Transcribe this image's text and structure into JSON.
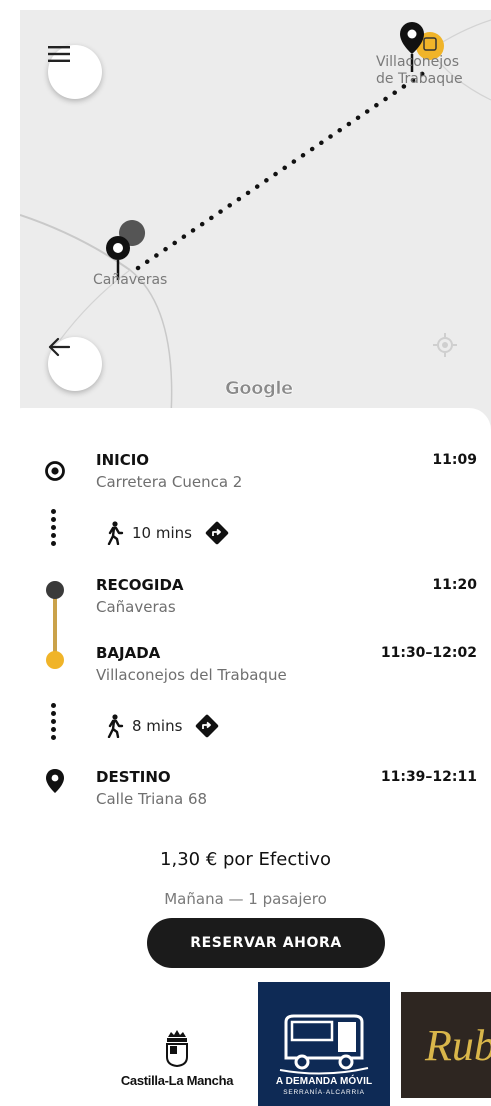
{
  "map": {
    "town_origin": "Villaconejos\nde Trabaque",
    "town_destination": "Cañaveras",
    "provider_logo": "Google",
    "menu_icon": "hamburger-menu-icon",
    "back_icon": "arrow-left-icon",
    "locate_icon": "crosshair-icon"
  },
  "trip": {
    "start": {
      "label": "INICIO",
      "address": "Carretera Cuenca 2",
      "time": "11:09"
    },
    "walk1": {
      "duration": "10 mins"
    },
    "pickup": {
      "label": "RECOGIDA",
      "address": "Cañaveras",
      "time": "11:20"
    },
    "dropoff": {
      "label": "BAJADA",
      "address": "Villaconejos del Trabaque",
      "time": "11:30–12:02"
    },
    "walk2": {
      "duration": "8 mins"
    },
    "destination": {
      "label": "DESTINO",
      "address": "Calle Triana 68",
      "time": "11:39–12:11"
    }
  },
  "booking": {
    "price": "1,30 € por Efectivo",
    "details": "Mañana — 1 pasajero",
    "button_label": "RESERVAR AHORA"
  },
  "logos": {
    "clm": "Castilla-La Mancha",
    "adm_title": "A DEMANDA MÓVIL",
    "adm_sub": "SERRANÍA·ALCARRIA",
    "rub": "Rub"
  },
  "colors": {
    "accent_yellow": "#f0b429",
    "route_dark": "#3a3a3a",
    "button_bg": "#1b1b1b",
    "adm_blue": "#0e2a55"
  }
}
